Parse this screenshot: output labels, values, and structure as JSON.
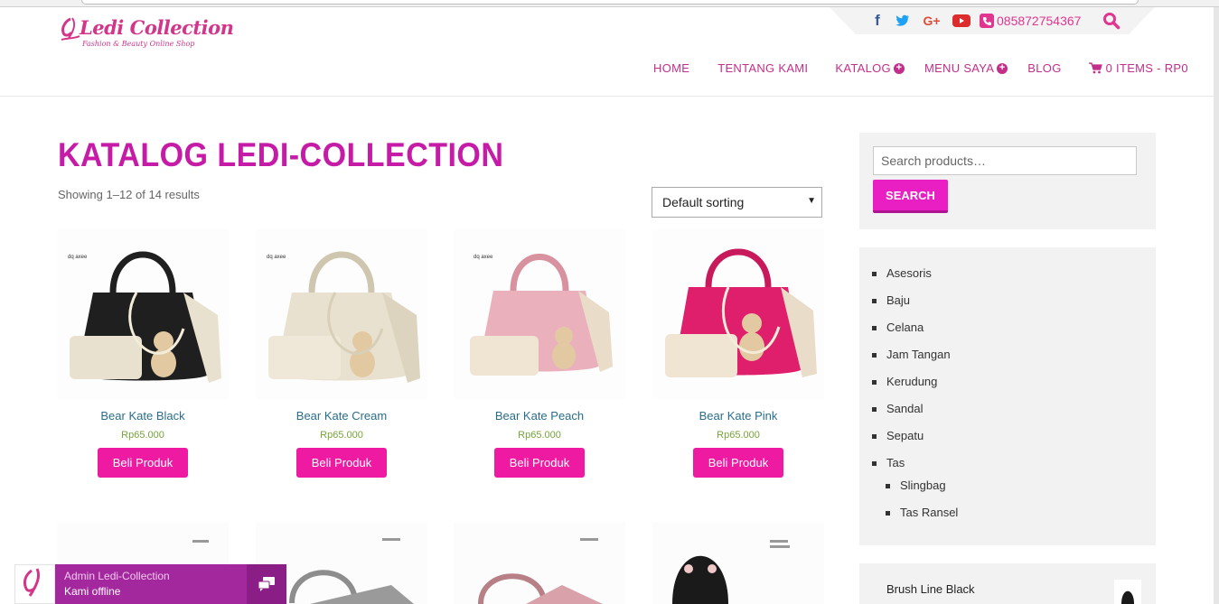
{
  "brand": {
    "name": "Ledi Collection",
    "tagline": "Fashion & Beauty Online Shop"
  },
  "topbar": {
    "phone": "085872754367",
    "icons": [
      "facebook-icon",
      "twitter-icon",
      "google-plus-icon",
      "youtube-icon",
      "phone-icon",
      "search-icon"
    ]
  },
  "nav": {
    "home": "HOME",
    "about": "TENTANG KAMI",
    "catalog": "KATALOG",
    "menu": "MENU SAYA",
    "blog": "BLOG",
    "cart": "0 ITEMS - RP0"
  },
  "page": {
    "title": "KATALOG LEDI-COLLECTION",
    "result_count": "Showing 1–12 of 14 results",
    "sorting": "Default sorting"
  },
  "products": [
    {
      "name": "Bear Kate Black",
      "price": "Rp65.000",
      "button": "Beli Produk",
      "color": "#1f1f1f"
    },
    {
      "name": "Bear Kate Cream",
      "price": "Rp65.000",
      "button": "Beli Produk",
      "color": "#e9e1cf"
    },
    {
      "name": "Bear Kate Peach",
      "price": "Rp65.000",
      "button": "Beli Produk",
      "color": "#eab1bd"
    },
    {
      "name": "Bear Kate Pink",
      "price": "Rp65.000",
      "button": "Beli Produk",
      "color": "#e01f6c"
    }
  ],
  "sidebar": {
    "search_placeholder": "Search products…",
    "search_button": "SEARCH",
    "categories": [
      "Asesoris",
      "Baju",
      "Celana",
      "Jam Tangan",
      "Kerudung",
      "Sandal",
      "Sepatu",
      "Tas"
    ],
    "subcategories": [
      "Slingbag",
      "Tas Ransel"
    ],
    "recent_product": "Brush Line Black"
  },
  "chat": {
    "title": "Admin Ledi-Collection",
    "status": "Kami offline"
  },
  "colors": {
    "accent": "#c51ba6",
    "button": "#ee1aa1",
    "link": "#2a6d8a",
    "price": "#78a23c"
  }
}
